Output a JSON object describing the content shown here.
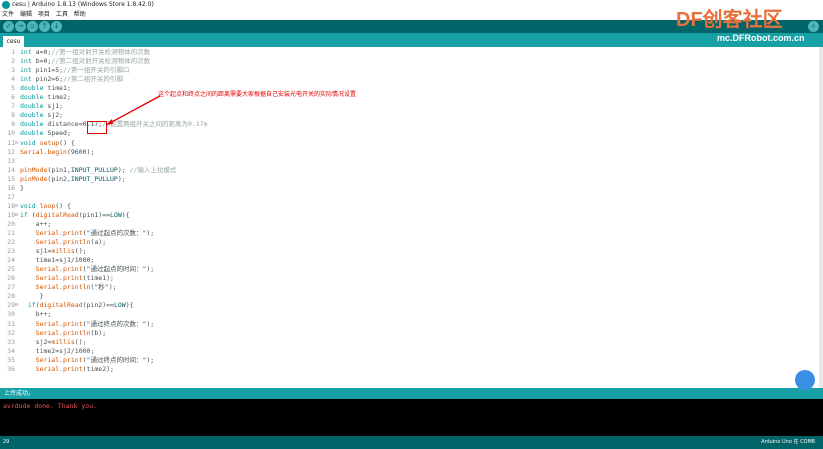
{
  "window": {
    "title": "cesu | Arduino 1.8.13 (Windows Store 1.8.42.0)"
  },
  "menu": [
    "文件",
    "编辑",
    "项目",
    "工具",
    "帮助"
  ],
  "toolbar": {
    "verify_icon": "check-icon",
    "upload_icon": "arrow-right-icon",
    "new_icon": "new-file-icon",
    "open_icon": "arrow-up-icon",
    "save_icon": "arrow-down-icon",
    "serial_icon": "magnifier-icon"
  },
  "tab": {
    "label": "cesu"
  },
  "code_lines": [
    {
      "n": "1",
      "parts": [
        [
          "kw",
          "int"
        ],
        [
          "",
          "a=0;"
        ],
        [
          "cm",
          "//第一组对射开关检测物体的次数"
        ]
      ]
    },
    {
      "n": "2",
      "parts": [
        [
          "kw",
          "int"
        ],
        [
          "",
          "b=0;"
        ],
        [
          "cm",
          "//第二组对射开关检测物体的次数"
        ]
      ]
    },
    {
      "n": "3",
      "parts": [
        [
          "kw",
          "int"
        ],
        [
          "",
          "pin1=5;"
        ],
        [
          "cm",
          "//第一组开关的引脚口"
        ]
      ]
    },
    {
      "n": "4",
      "parts": [
        [
          "kw",
          "int"
        ],
        [
          "",
          "pin2=6;"
        ],
        [
          "cm",
          "//第二组开关的引脚"
        ]
      ]
    },
    {
      "n": "5",
      "parts": [
        [
          "kw",
          "double"
        ],
        [
          "",
          "time1;"
        ]
      ]
    },
    {
      "n": "6",
      "parts": [
        [
          "kw",
          "double"
        ],
        [
          "",
          "time2;"
        ]
      ]
    },
    {
      "n": "7",
      "parts": [
        [
          "kw",
          "double"
        ],
        [
          "",
          "sj1;"
        ]
      ]
    },
    {
      "n": "8",
      "parts": [
        [
          "kw",
          "double"
        ],
        [
          "",
          "sj2;"
        ]
      ]
    },
    {
      "n": "9",
      "parts": [
        [
          "kw",
          "double"
        ],
        [
          "",
          "distance=0.17;"
        ],
        [
          "cm",
          "//设置两组开关之间的距离为0.17m"
        ]
      ]
    },
    {
      "n": "10",
      "parts": [
        [
          "kw",
          "double"
        ],
        [
          "",
          "Speed;"
        ]
      ]
    },
    {
      "n": "11",
      "fold": true,
      "parts": [
        [
          "kw",
          "void"
        ],
        [
          "fn",
          "setup"
        ],
        [
          "",
          "() {"
        ]
      ]
    },
    {
      "n": "12",
      "parts": [
        [
          "fn",
          "Serial.begin"
        ],
        [
          "",
          "(9600);"
        ]
      ]
    },
    {
      "n": "13",
      "parts": []
    },
    {
      "n": "14",
      "parts": [
        [
          "fn",
          "pinMode"
        ],
        [
          "",
          "(pin1,"
        ],
        [
          "st",
          "INPUT_PULLUP"
        ],
        [
          "",
          "); "
        ],
        [
          "cm",
          "//输入上拉模式"
        ]
      ]
    },
    {
      "n": "15",
      "parts": [
        [
          "fn",
          "pinMode"
        ],
        [
          "",
          "(pin2,"
        ],
        [
          "st",
          "INPUT_PULLUP"
        ],
        [
          "",
          ");"
        ]
      ]
    },
    {
      "n": "16",
      "parts": [
        [
          "",
          "}"
        ]
      ]
    },
    {
      "n": "17",
      "parts": []
    },
    {
      "n": "18",
      "fold": true,
      "parts": [
        [
          "kw",
          "void"
        ],
        [
          "fn",
          "loop"
        ],
        [
          "",
          "() {"
        ]
      ]
    },
    {
      "n": "19",
      "fold": true,
      "parts": [
        [
          "kw",
          "if"
        ],
        [
          "",
          "("
        ],
        [
          "fn",
          "digitalRead"
        ],
        [
          "",
          "(pin1)=="
        ],
        [
          "st",
          "LOW"
        ],
        [
          "",
          "){"
        ]
      ]
    },
    {
      "n": "20",
      "parts": [
        [
          "",
          "    a++;"
        ]
      ]
    },
    {
      "n": "21",
      "parts": [
        [
          "fn",
          "    Serial.print"
        ],
        [
          "",
          "(\"通过起点的次数：\");"
        ]
      ]
    },
    {
      "n": "22",
      "parts": [
        [
          "fn",
          "    Serial.println"
        ],
        [
          "",
          "(a);"
        ]
      ]
    },
    {
      "n": "23",
      "parts": [
        [
          "",
          "    sj1="
        ],
        [
          "fn",
          "millis"
        ],
        [
          "",
          "();"
        ]
      ]
    },
    {
      "n": "24",
      "parts": [
        [
          "",
          "    time1=sj1/1000;"
        ]
      ]
    },
    {
      "n": "25",
      "parts": [
        [
          "fn",
          "    Serial.print"
        ],
        [
          "",
          "(\"通过起点的时间：\");"
        ]
      ]
    },
    {
      "n": "26",
      "parts": [
        [
          "fn",
          "    Serial.print"
        ],
        [
          "",
          "(time1);"
        ]
      ]
    },
    {
      "n": "27",
      "parts": [
        [
          "fn",
          "    Serial.println"
        ],
        [
          "",
          "(\"秒\");"
        ]
      ]
    },
    {
      "n": "28",
      "parts": [
        [
          "",
          "     }"
        ]
      ]
    },
    {
      "n": "29",
      "fold": true,
      "parts": [
        [
          "kw",
          "  if"
        ],
        [
          "",
          "("
        ],
        [
          "fn",
          "digitalRead"
        ],
        [
          "",
          "(pin2)=="
        ],
        [
          "st",
          "LOW"
        ],
        [
          "",
          "){"
        ]
      ]
    },
    {
      "n": "30",
      "parts": [
        [
          "",
          "    b++;"
        ]
      ]
    },
    {
      "n": "31",
      "parts": [
        [
          "fn",
          "    Serial.print"
        ],
        [
          "",
          "(\"通过终点的次数：\");"
        ]
      ]
    },
    {
      "n": "32",
      "parts": [
        [
          "fn",
          "    Serial.println"
        ],
        [
          "",
          "(b);"
        ]
      ]
    },
    {
      "n": "33",
      "parts": [
        [
          "",
          "    sj2="
        ],
        [
          "fn",
          "millis"
        ],
        [
          "",
          "();"
        ]
      ]
    },
    {
      "n": "34",
      "parts": [
        [
          "",
          "    time2=sj2/1000;"
        ]
      ]
    },
    {
      "n": "35",
      "parts": [
        [
          "fn",
          "    Serial.print"
        ],
        [
          "",
          "(\"通过终点的时间：\");"
        ]
      ]
    },
    {
      "n": "36",
      "parts": [
        [
          "fn",
          "    Serial.print"
        ],
        [
          "",
          "(time2);"
        ]
      ]
    }
  ],
  "annotation": {
    "text": "这个起点和终点之间的距离需要大家根据自己安装光电开关的实际情况设置"
  },
  "status": {
    "text": "上传成功。"
  },
  "console": {
    "text": "avrdude done.  Thank you."
  },
  "bottom": {
    "line": "29",
    "board": "Arduino Uno 在 COM8"
  },
  "watermark": {
    "logo": "DF创客社区",
    "url": "mc.DFRobot.com.cn"
  }
}
